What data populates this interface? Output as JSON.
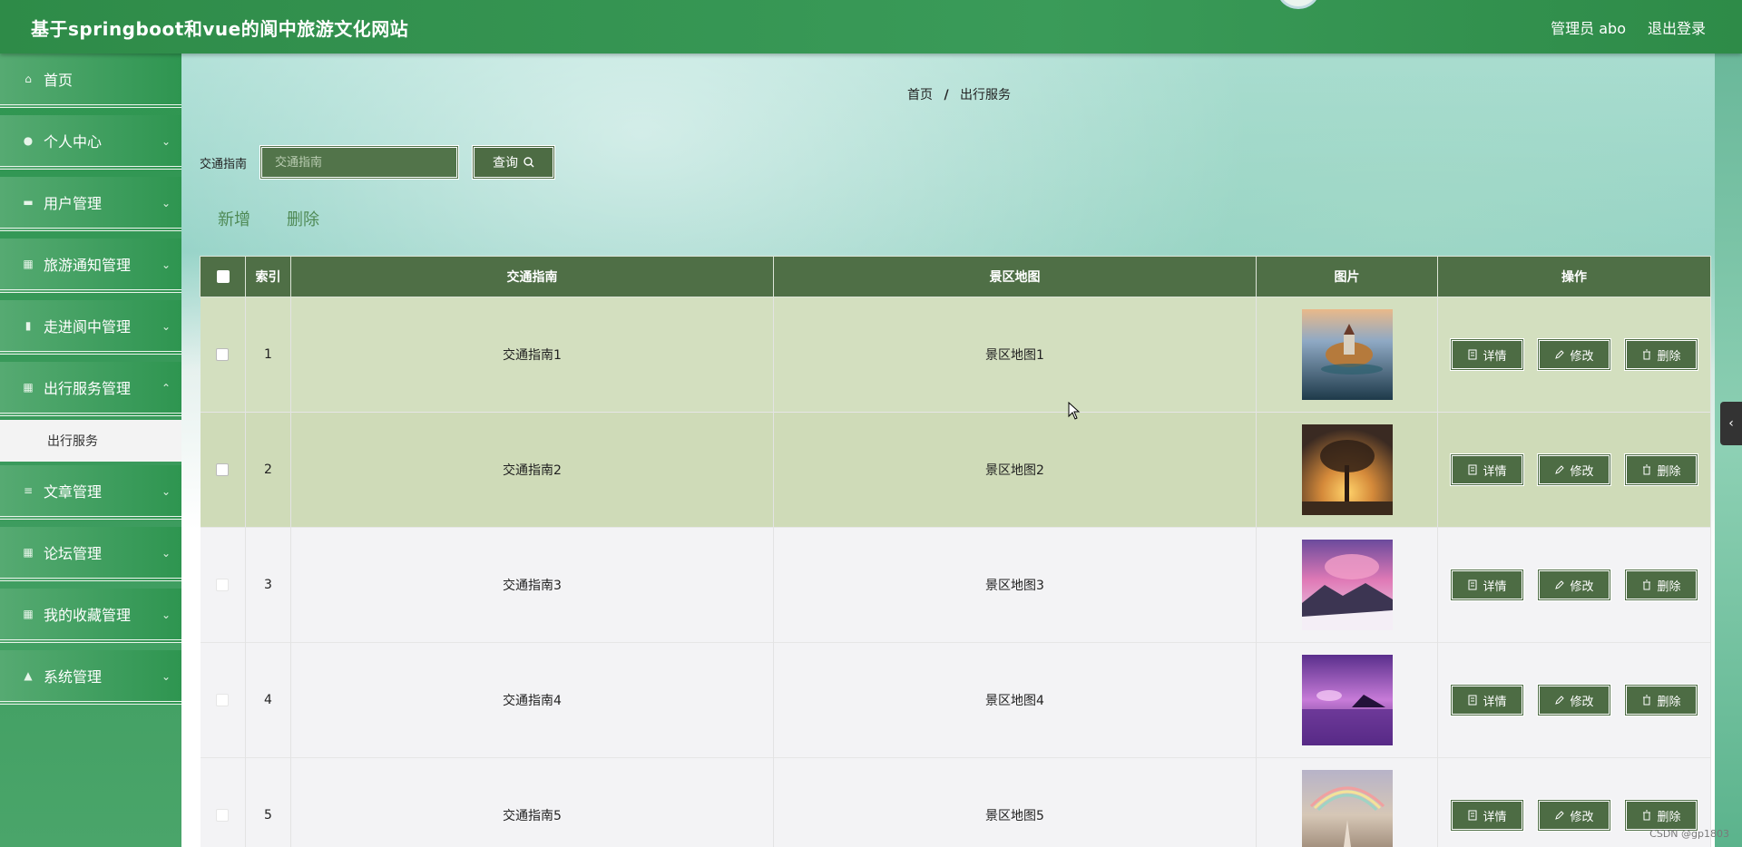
{
  "header": {
    "title": "基于springboot和vue的阆中旅游文化网站",
    "user_label": "管理员 abo",
    "logout_label": "退出登录"
  },
  "sidebar": {
    "items": [
      {
        "label": "首页",
        "icon": "home-icon",
        "chevron": false
      },
      {
        "label": "个人中心",
        "icon": "user-icon",
        "chevron": true
      },
      {
        "label": "用户管理",
        "icon": "monitor-icon",
        "chevron": true
      },
      {
        "label": "旅游通知管理",
        "icon": "grid-icon",
        "chevron": true
      },
      {
        "label": "走进阆中管理",
        "icon": "comment-icon",
        "chevron": true
      },
      {
        "label": "出行服务管理",
        "icon": "grid-icon",
        "chevron": true,
        "expanded": true
      },
      {
        "label": "文章管理",
        "icon": "list-icon",
        "chevron": true
      },
      {
        "label": "论坛管理",
        "icon": "grid-icon",
        "chevron": true
      },
      {
        "label": "我的收藏管理",
        "icon": "grid-icon",
        "chevron": true
      },
      {
        "label": "系统管理",
        "icon": "thumb-icon",
        "chevron": true
      }
    ],
    "submenu_label": "出行服务"
  },
  "breadcrumb": {
    "home": "首页",
    "separator": "/",
    "current": "出行服务"
  },
  "search": {
    "label": "交通指南",
    "placeholder": "交通指南",
    "button_label": "查询"
  },
  "actions": {
    "add_label": "新增",
    "delete_label": "删除"
  },
  "table": {
    "columns": [
      "索引",
      "交通指南",
      "景区地图",
      "图片",
      "操作"
    ],
    "rows": [
      {
        "index": "1",
        "guide": "交通指南1",
        "map": "景区地图1",
        "image": "castle-lake-photo"
      },
      {
        "index": "2",
        "guide": "交通指南2",
        "map": "景区地图2",
        "image": "tree-sunset-photo"
      },
      {
        "index": "3",
        "guide": "交通指南3",
        "map": "景区地图3",
        "image": "pink-mountain-photo"
      },
      {
        "index": "4",
        "guide": "交通指南4",
        "map": "景区地图4",
        "image": "purple-sea-photo"
      },
      {
        "index": "5",
        "guide": "交通指南5",
        "map": "景区地图5",
        "image": "rainbow-path-photo"
      }
    ],
    "op_labels": {
      "detail": "详情",
      "edit": "修改",
      "delete": "删除"
    }
  },
  "watermark": "CSDN @gp1803",
  "colors": {
    "header_green": "#2e8b48",
    "button_green": "#4d6c44",
    "table_head": "#4f6f46",
    "highlight_row": "#d3dfbf"
  }
}
